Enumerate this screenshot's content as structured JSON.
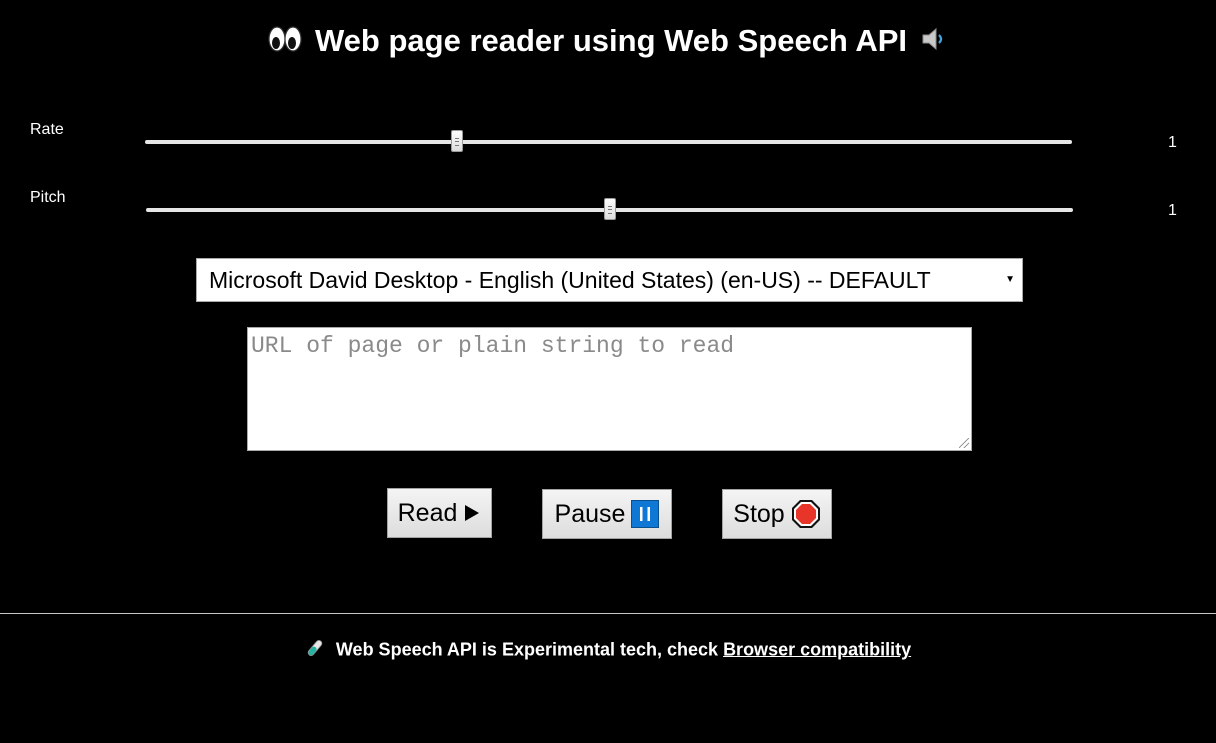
{
  "header": {
    "title": "Web page reader using Web Speech API",
    "left_icon": "eyes-icon",
    "right_icon": "speaker-icon"
  },
  "rate": {
    "label": "Rate",
    "value": "1",
    "level": 0.337
  },
  "pitch": {
    "label": "Pitch",
    "value": "1",
    "level": 0.5
  },
  "voice_select": {
    "selected": "Microsoft David Desktop - English (United States) (en-US) -- DEFAULT"
  },
  "text_input": {
    "placeholder": "URL of page or plain string to read",
    "value": ""
  },
  "buttons": {
    "read": {
      "label": "Read",
      "icon": "play-icon"
    },
    "pause": {
      "label": "Pause",
      "icon": "pause-icon"
    },
    "stop": {
      "label": "Stop",
      "icon": "stop-sign-icon"
    }
  },
  "footer": {
    "icon": "test-tube-icon",
    "text": "Web Speech API is Experimental tech, check",
    "link": "Browser compatibility"
  },
  "colors": {
    "background": "#000000",
    "text": "#ffffff",
    "pause_icon": "#0f78d4",
    "stop_icon": "#e8352a",
    "test_tube": "#27b3a0"
  }
}
